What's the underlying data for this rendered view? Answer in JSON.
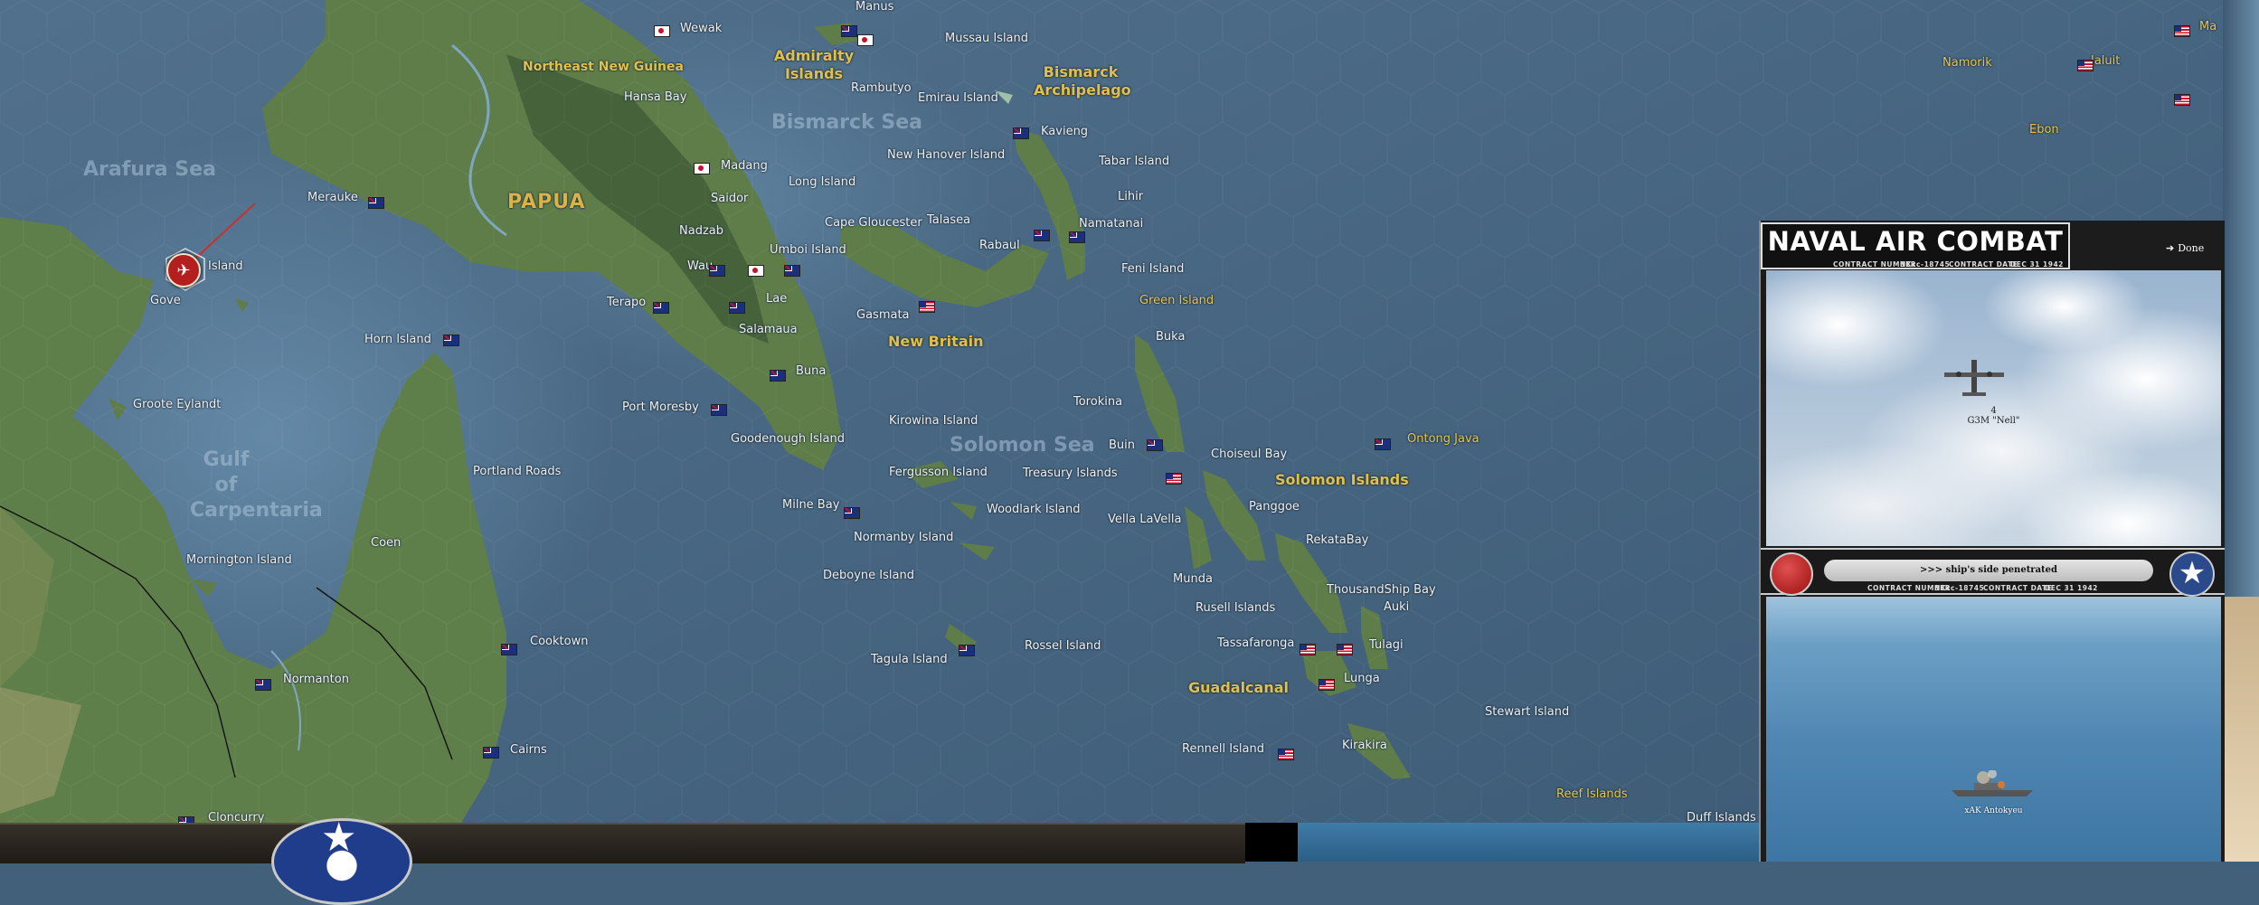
{
  "map": {
    "sea_labels": [
      "Arafura Sea",
      "Gulf of Carpentaria",
      "Bismarck Sea",
      "Solomon Sea"
    ],
    "region_labels": [
      "Northeast New Guinea",
      "PAPUA",
      "Admiralty Islands",
      "Bismarck Archipelago",
      "New Britain",
      "Solomon Islands",
      "Guadalcanal",
      "Green Island",
      "Ontong Java",
      "Reef Islands",
      "Namorik",
      "Jaluit",
      "Ebon",
      "Ma"
    ],
    "place_labels": [
      "Manus",
      "Wewak",
      "Mussau Island",
      "Hansa Bay",
      "Rambutyo",
      "Emirau Island",
      "Kavieng",
      "Madang",
      "New Hanover Island",
      "Tabar Island",
      "Merauke",
      "Saidor",
      "Long Island",
      "Lihir",
      "Island",
      "Nadzab",
      "Cape Gloucester",
      "Talasea",
      "Namatanai",
      "Gove",
      "Wau",
      "Umboi Island",
      "Rabaul",
      "Feni Island",
      "Lae",
      "Gasmata",
      "Terapo",
      "Salamaua",
      "Horn Island",
      "Buka",
      "Buna",
      "Groote Eylandt",
      "Torokina",
      "Port Moresby",
      "Kirowina Island",
      "Goodenough Island",
      "Buin",
      "Choiseul Bay",
      "Portland Roads",
      "Fergusson Island",
      "Treasury Islands",
      "Panggoe",
      "Milne Bay",
      "Woodlark Island",
      "Vella LaVella",
      "Coen",
      "Normanby Island",
      "RekataBay",
      "Mornington Island",
      "Munda",
      "Deboyne Island",
      "ThousandShip Bay",
      "Rusell Islands",
      "Auki",
      "Tassafaronga",
      "Tulagi",
      "Cooktown",
      "Tagula Island",
      "Rossel Island",
      "Lunga",
      "Normanton",
      "Stewart Island",
      "Kirakira",
      "Cairns",
      "Rennell Island",
      "Duff Islands",
      "Cloncurry"
    ]
  },
  "panel": {
    "title": "NAVAL AIR COMBAT",
    "contract_number_label": "CONTRACT NUMBER",
    "contract_number": "NKcc-18745",
    "contract_date_label": "CONTRACT DATE",
    "contract_date": "DEC 31 1942",
    "done_label": "Done",
    "aircraft_count": "4",
    "aircraft_name": "G3M \"Nell\"",
    "status_message": ">>> ship's side penetrated",
    "ship_name": "xAK Antokyeu"
  },
  "colors": {
    "sea": "#43607a",
    "land": "#5f7f4a",
    "region_label": "#e0c04a",
    "panel_bg": "#1c1c1c"
  },
  "icons": [
    "us-flag-icon",
    "australia-flag-icon",
    "japan-flag-icon",
    "unit-marker-icon",
    "aircraft-icon",
    "ship-icon",
    "star-icon",
    "done-arrow-icon"
  ]
}
